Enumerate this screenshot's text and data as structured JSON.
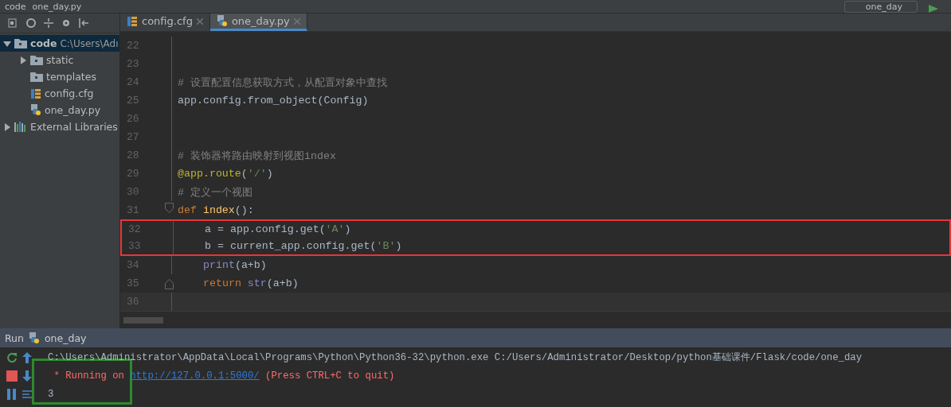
{
  "breadcrumbs": [
    "code",
    "one_day.py"
  ],
  "run_config": {
    "label": "one_day"
  },
  "project_tree": [
    {
      "label": "code",
      "path": "C:\\Users\\Adı",
      "kind": "folder",
      "expanded": true,
      "selected": true,
      "children": [
        {
          "label": "static",
          "kind": "folder",
          "expanded": false,
          "selected": false
        },
        {
          "label": "templates",
          "kind": "folder",
          "selected": false
        },
        {
          "label": "config.cfg",
          "kind": "config",
          "selected": false
        },
        {
          "label": "one_day.py",
          "kind": "python",
          "selected": false
        }
      ]
    },
    {
      "label": "External Libraries",
      "kind": "library",
      "expanded": false,
      "selected": false
    }
  ],
  "editor_tabs": [
    {
      "label": "config.cfg",
      "kind": "config",
      "selected": false
    },
    {
      "label": "one_day.py",
      "kind": "python",
      "selected": true
    }
  ],
  "code_lines": [
    {
      "number": "22"
    },
    {
      "number": "23"
    },
    {
      "number": "24",
      "tokens": [
        {
          "text": "# 设置配置信息获取方式，从配置对象中查找",
          "kind": "comment"
        }
      ]
    },
    {
      "number": "25",
      "tokens": [
        {
          "text": "app.config.from_object(Config)",
          "kind": "plain"
        }
      ]
    },
    {
      "number": "26"
    },
    {
      "number": "27"
    },
    {
      "number": "28",
      "tokens": [
        {
          "text": "# 装饰器将路由映射到视图index",
          "kind": "comment"
        }
      ]
    },
    {
      "number": "29",
      "tokens": [
        {
          "text": "@app.route",
          "kind": "decorator"
        },
        {
          "text": "(",
          "kind": "plain"
        },
        {
          "text": "'/'",
          "kind": "string"
        },
        {
          "text": ")",
          "kind": "plain"
        }
      ]
    },
    {
      "number": "30",
      "tokens": [
        {
          "text": "# 定义一个视图",
          "kind": "comment"
        }
      ]
    },
    {
      "number": "31",
      "fold_open": true,
      "tokens": [
        {
          "text": "def ",
          "kind": "keyword"
        },
        {
          "text": "index",
          "kind": "function"
        },
        {
          "text": "():",
          "kind": "plain"
        }
      ]
    },
    {
      "number": "32",
      "boxed": true,
      "indented": true,
      "tokens": [
        {
          "text": "a = app.config.get(",
          "kind": "plain"
        },
        {
          "text": "'A'",
          "kind": "string"
        },
        {
          "text": ")",
          "kind": "plain"
        }
      ]
    },
    {
      "number": "33",
      "boxed": true,
      "indented": true,
      "tokens": [
        {
          "text": "b = current_app.config.get(",
          "kind": "plain"
        },
        {
          "text": "'B'",
          "kind": "string"
        },
        {
          "text": ")",
          "kind": "plain"
        }
      ]
    },
    {
      "number": "34",
      "indented": true,
      "tokens": [
        {
          "text": "print",
          "kind": "builtin"
        },
        {
          "text": "(a+b)",
          "kind": "plain"
        }
      ]
    },
    {
      "number": "35",
      "fold_close": true,
      "indented": true,
      "tokens": [
        {
          "text": "return ",
          "kind": "keyword"
        },
        {
          "text": "str",
          "kind": "builtin"
        },
        {
          "text": "(a+b)",
          "kind": "plain"
        }
      ]
    },
    {
      "number": "36",
      "current": true
    }
  ],
  "run_panel": {
    "title": "Run",
    "config": "one_day",
    "output": [
      {
        "tokens": [
          {
            "text": "C:\\Users\\Administrator\\AppData\\Local\\Programs\\Python\\Python36-32\\python.exe C:/Users/Administrator/Desktop/python基础课件/Flask/code/one_day",
            "kind": "plain"
          }
        ]
      },
      {
        "tokens": [
          {
            "text": " * Running on ",
            "kind": "error"
          },
          {
            "text": "http://127.0.0.1:5000/",
            "kind": "link"
          },
          {
            "text": " (Press CTRL+C to quit)",
            "kind": "error"
          }
        ]
      },
      {
        "tokens": [
          {
            "text": "3",
            "kind": "plain"
          }
        ]
      }
    ]
  }
}
